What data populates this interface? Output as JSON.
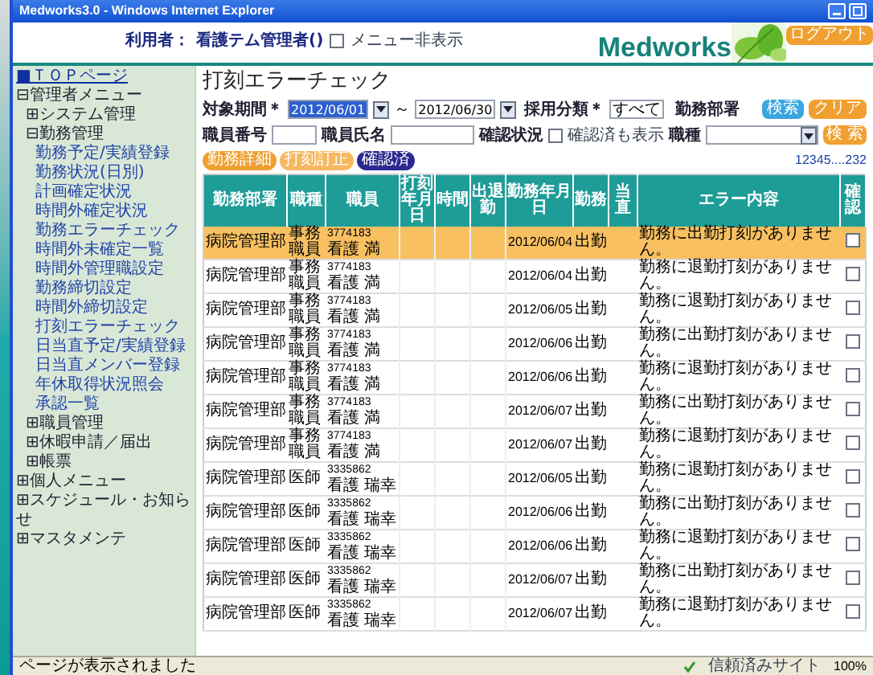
{
  "window": {
    "title": "Medworks3.0 - Windows Internet Explorer"
  },
  "header": {
    "user_label": "利用者：",
    "user_name": "看護テム管理者()",
    "hide_menu": {
      "label": "メニュー非表示",
      "checked": false
    },
    "logo": "Medworks",
    "logout": "ログアウト"
  },
  "sidebar": {
    "items": [
      {
        "label": "■ＴＯＰページ",
        "kind": "link"
      },
      {
        "label": "⊟管理者メニュー",
        "kind": "group",
        "children": [
          {
            "label": "⊞システム管理",
            "kind": "group"
          },
          {
            "label": "⊟勤務管理",
            "kind": "group",
            "children": [
              {
                "label": "勤務予定/実績登録"
              },
              {
                "label": "勤務状況(日別)"
              },
              {
                "label": "計画確定状況"
              },
              {
                "label": "時間外確定状況"
              },
              {
                "label": "勤務エラーチェック"
              },
              {
                "label": "時間外未確定一覧"
              },
              {
                "label": "時間外管理職設定"
              },
              {
                "label": "勤務締切設定"
              },
              {
                "label": "時間外締切設定"
              },
              {
                "label": "打刻エラーチェック"
              },
              {
                "label": "日当直予定/実績登録"
              },
              {
                "label": "日当直メンバー登録"
              },
              {
                "label": "年休取得状況照会"
              },
              {
                "label": "承認一覧"
              }
            ]
          },
          {
            "label": "⊞職員管理",
            "kind": "group"
          },
          {
            "label": "⊞休暇申請／届出",
            "kind": "group"
          },
          {
            "label": "⊞帳票",
            "kind": "group"
          }
        ]
      },
      {
        "label": "⊞個人メニュー",
        "kind": "group"
      },
      {
        "label": "⊞スケジュール・お知らせ",
        "kind": "group"
      },
      {
        "label": "⊞マスタメンテ",
        "kind": "group"
      }
    ]
  },
  "page_title": "打刻エラーチェック",
  "filters": {
    "period_label": "対象期間＊",
    "date_from": "2012/06/01",
    "tilde": "～",
    "date_to": "2012/06/30",
    "employment_label": "採用分類＊",
    "employment_value": "すべて",
    "dept_label": "勤務部署",
    "search": "検索",
    "clear": "クリア",
    "staff_no_label": "職員番号",
    "staff_name_label": "職員氏名",
    "confirm_label": "確認状況",
    "show_confirmed": {
      "label": "確認済も表示",
      "checked": false
    },
    "job_label": "職種",
    "job_search": "検 索"
  },
  "actions": [
    "勤務詳細",
    "打刻訂正",
    "確認済"
  ],
  "pagination": "12345....232",
  "table": {
    "columns": [
      "勤務部署",
      "職種",
      "職員",
      "打刻年月日",
      "時間",
      "出退勤",
      "勤務年月日",
      "勤務",
      "当直",
      "エラー内容",
      "確認"
    ],
    "rows": [
      {
        "dept": "病院管理部",
        "job": "事務職員",
        "staff_id": "3774183",
        "staff_name": "看護 満",
        "date": "2012/06/04",
        "work": "出勤",
        "error": "勤務に出勤打刻がありません。",
        "checked": false,
        "selected": true
      },
      {
        "dept": "病院管理部",
        "job": "事務職員",
        "staff_id": "3774183",
        "staff_name": "看護 満",
        "date": "2012/06/04",
        "work": "出勤",
        "error": "勤務に退勤打刻がありません。",
        "checked": false,
        "selected": false
      },
      {
        "dept": "病院管理部",
        "job": "事務職員",
        "staff_id": "3774183",
        "staff_name": "看護 満",
        "date": "2012/06/05",
        "work": "出勤",
        "error": "勤務に退勤打刻がありません。",
        "checked": false,
        "selected": false
      },
      {
        "dept": "病院管理部",
        "job": "事務職員",
        "staff_id": "3774183",
        "staff_name": "看護 満",
        "date": "2012/06/06",
        "work": "出勤",
        "error": "勤務に出勤打刻がありません。",
        "checked": false,
        "selected": false
      },
      {
        "dept": "病院管理部",
        "job": "事務職員",
        "staff_id": "3774183",
        "staff_name": "看護 満",
        "date": "2012/06/06",
        "work": "出勤",
        "error": "勤務に退勤打刻がありません。",
        "checked": false,
        "selected": false
      },
      {
        "dept": "病院管理部",
        "job": "事務職員",
        "staff_id": "3774183",
        "staff_name": "看護 満",
        "date": "2012/06/07",
        "work": "出勤",
        "error": "勤務に出勤打刻がありません。",
        "checked": false,
        "selected": false
      },
      {
        "dept": "病院管理部",
        "job": "事務職員",
        "staff_id": "3774183",
        "staff_name": "看護 満",
        "date": "2012/06/07",
        "work": "出勤",
        "error": "勤務に退勤打刻がありません。",
        "checked": false,
        "selected": false
      },
      {
        "dept": "病院管理部",
        "job": "医師",
        "staff_id": "3335862",
        "staff_name": "看護 瑞幸",
        "date": "2012/06/05",
        "work": "出勤",
        "error": "勤務に退勤打刻がありません。",
        "checked": false,
        "selected": false
      },
      {
        "dept": "病院管理部",
        "job": "医師",
        "staff_id": "3335862",
        "staff_name": "看護 瑞幸",
        "date": "2012/06/06",
        "work": "出勤",
        "error": "勤務に出勤打刻がありません。",
        "checked": false,
        "selected": false
      },
      {
        "dept": "病院管理部",
        "job": "医師",
        "staff_id": "3335862",
        "staff_name": "看護 瑞幸",
        "date": "2012/06/06",
        "work": "出勤",
        "error": "勤務に退勤打刻がありません。",
        "checked": false,
        "selected": false
      },
      {
        "dept": "病院管理部",
        "job": "医師",
        "staff_id": "3335862",
        "staff_name": "看護 瑞幸",
        "date": "2012/06/07",
        "work": "出勤",
        "error": "勤務に出勤打刻がありません。",
        "checked": false,
        "selected": false
      },
      {
        "dept": "病院管理部",
        "job": "医師",
        "staff_id": "3335862",
        "staff_name": "看護 瑞幸",
        "date": "2012/06/07",
        "work": "出勤",
        "error": "勤務に退勤打刻がありません。",
        "checked": false,
        "selected": false
      }
    ]
  },
  "status_bar": {
    "message": "ページが表示されました",
    "zone": "信頼済みサイト",
    "zoom": "100%"
  }
}
